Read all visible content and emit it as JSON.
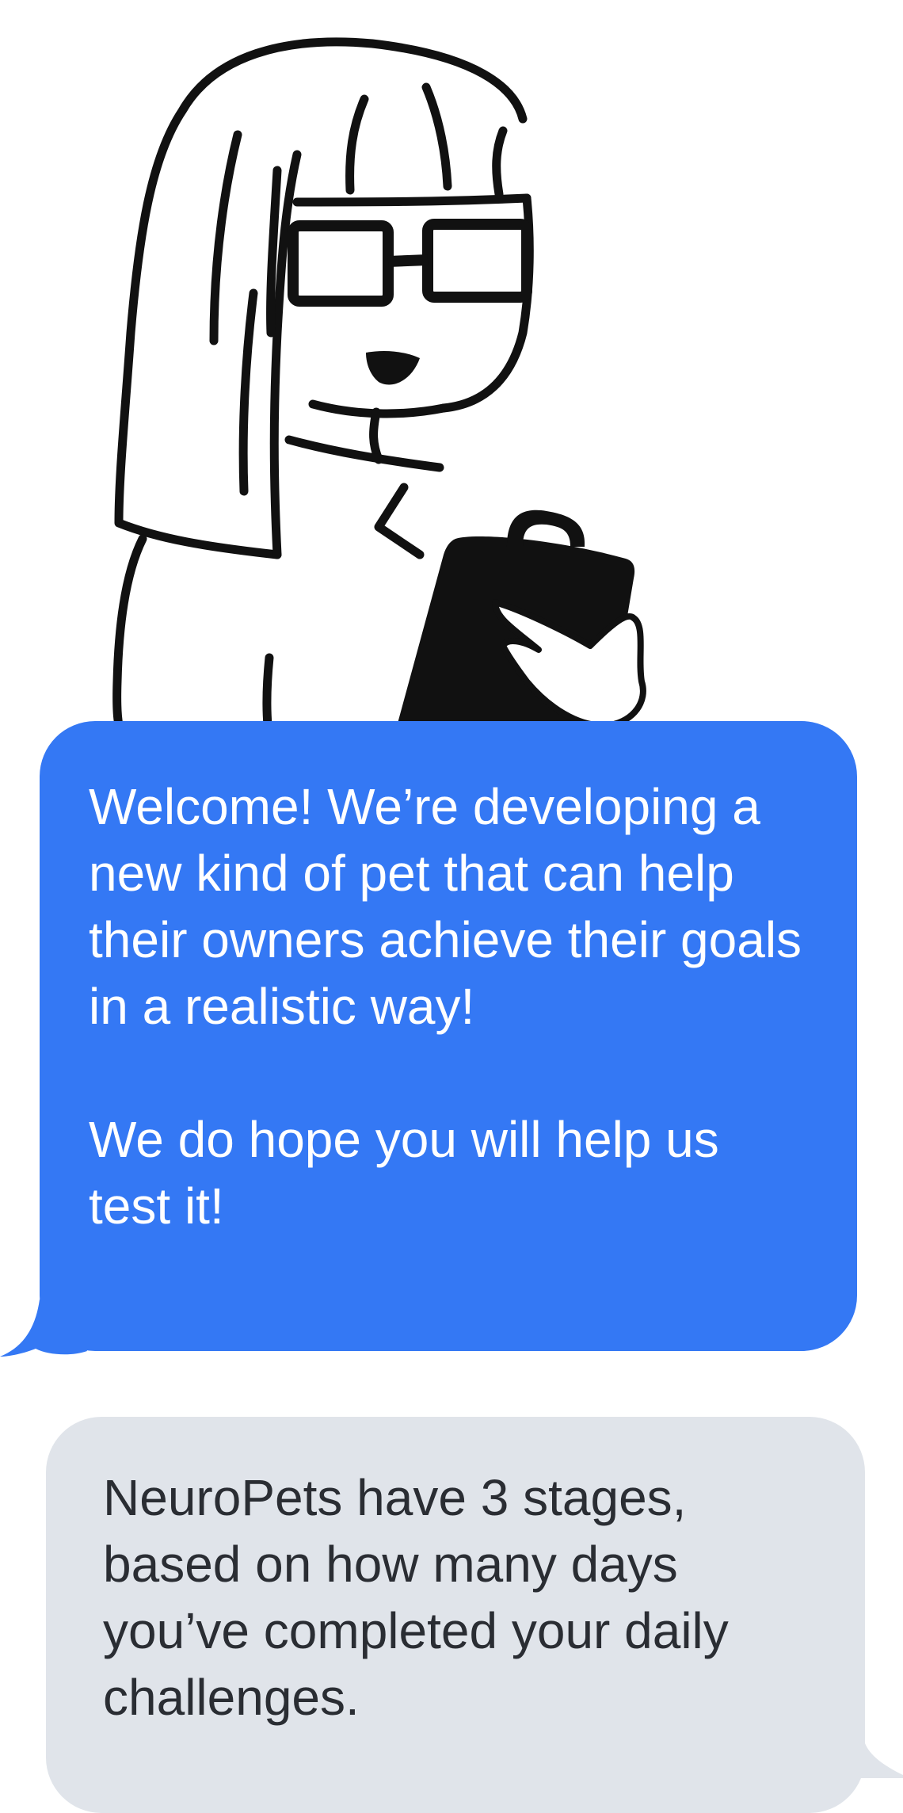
{
  "colors": {
    "incoming_bubble": "#3478f4",
    "outgoing_bubble": "#e0e4ea",
    "incoming_text": "#ffffff",
    "outgoing_text": "#2a2d33",
    "ink": "#111111"
  },
  "avatar": {
    "icon": "scientist-with-clipboard-illustration"
  },
  "messages": [
    {
      "paragraphs": [
        "Welcome! We’re developing a new kind of pet that can help their owners achieve their goals in a realistic way!",
        "We do hope you will help us test it!"
      ]
    },
    {
      "paragraphs": [
        "NeuroPets have 3 stages, based on how many days you’ve completed your daily challenges."
      ]
    }
  ]
}
